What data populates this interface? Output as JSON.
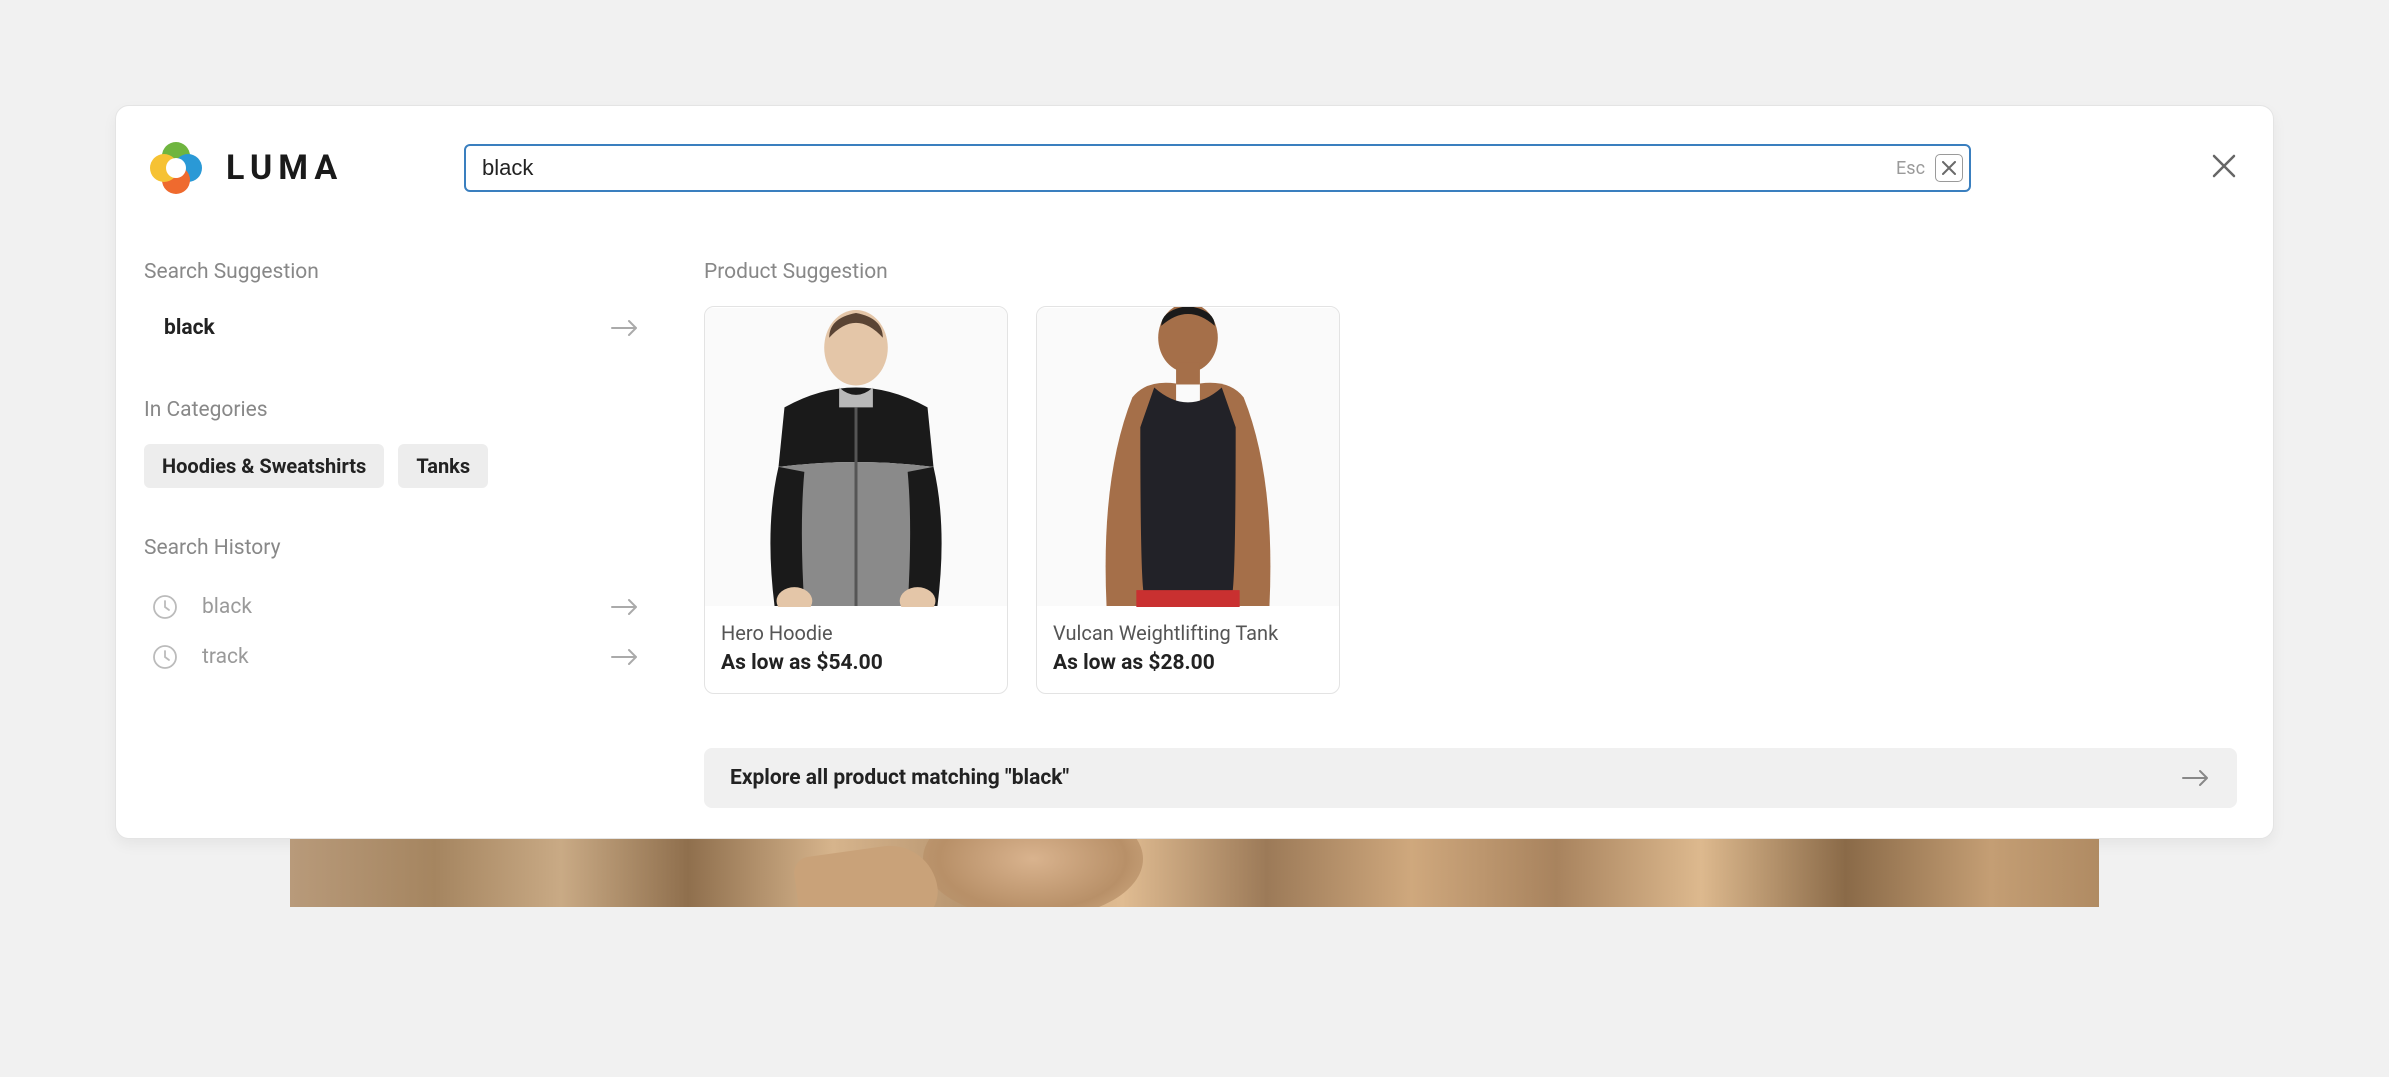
{
  "brand": {
    "name": "LUMA"
  },
  "search": {
    "value": "black",
    "esc_label": "Esc"
  },
  "sidebar": {
    "suggestion_title": "Search Suggestion",
    "suggestions": [
      {
        "text": "black"
      }
    ],
    "categories_title": "In Categories",
    "categories": [
      {
        "label": "Hoodies & Sweatshirts"
      },
      {
        "label": "Tanks"
      }
    ],
    "history_title": "Search History",
    "history": [
      {
        "text": "black"
      },
      {
        "text": "track"
      }
    ]
  },
  "main": {
    "product_title": "Product Suggestion",
    "products": [
      {
        "name": "Hero Hoodie",
        "price": "As low as $54.00"
      },
      {
        "name": "Vulcan Weightlifting Tank",
        "price": "As low as $28.00"
      }
    ],
    "explore_text": "Explore all product matching \"black\""
  }
}
